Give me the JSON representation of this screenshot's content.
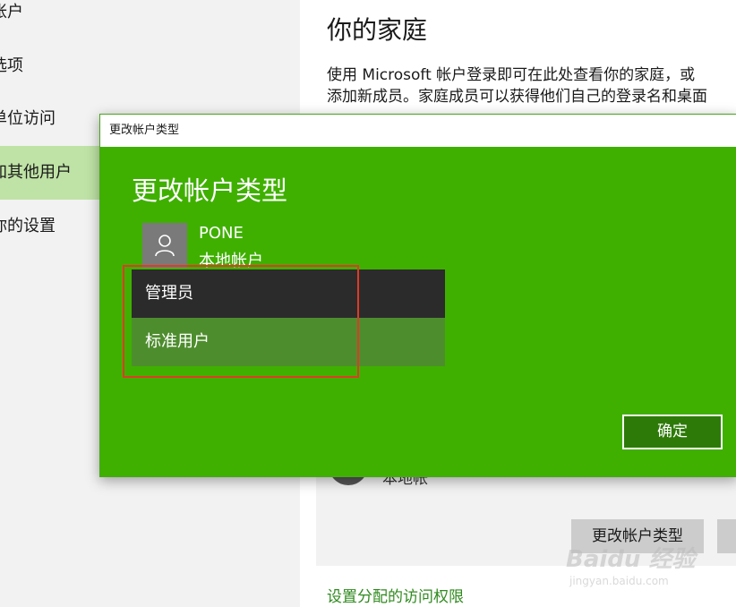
{
  "sidebar": {
    "items": [
      {
        "label": "帐户"
      },
      {
        "label": "选项"
      },
      {
        "label": "单位访问"
      },
      {
        "label": "加其他用户"
      },
      {
        "label": "你的设置"
      }
    ]
  },
  "main": {
    "title": "你的家庭",
    "description_line1": "使用 Microsoft 帐户登录即可在此处查看你的家庭，或",
    "description_line2": "添加新成员。家庭成员可以获得他们自己的登录名和桌面",
    "member_subtitle": "本地帐",
    "change_type_button": "更改帐户类型",
    "access_link": "设置分配的访问权限"
  },
  "dialog": {
    "window_title": "更改帐户类型",
    "heading": "更改帐户类型",
    "user": {
      "name": "PONE",
      "type": "本地帐户"
    },
    "account_type_options": [
      {
        "label": "管理员",
        "selected": true
      },
      {
        "label": "标准用户",
        "selected": false
      }
    ],
    "ok_button": "确定"
  },
  "watermark": {
    "text": "Baidu 经验",
    "sub": "jingyan.baidu.com"
  },
  "colors": {
    "dialog_bg": "#3fb000",
    "ok_button_bg": "#2e7a09",
    "option_selected_bg": "#2b2b2b",
    "option_normal_bg": "#4e8d2e",
    "sidebar_active": "#bfe3a6",
    "highlight": "#e03a28",
    "link": "#2f8a1e"
  }
}
